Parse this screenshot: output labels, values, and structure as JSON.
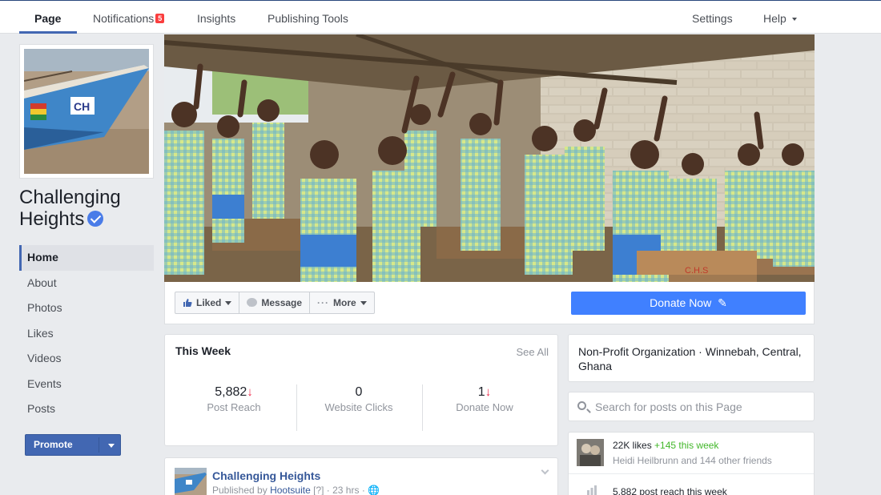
{
  "tabs": [
    {
      "label": "Page"
    },
    {
      "label": "Notifications",
      "badge": "5"
    },
    {
      "label": "Insights"
    },
    {
      "label": "Publishing Tools"
    }
  ],
  "tabs_right": [
    {
      "label": "Settings"
    },
    {
      "label": "Help"
    }
  ],
  "page": {
    "name": "Challenging Heights",
    "verified": true
  },
  "sidebar": {
    "items": [
      {
        "label": "Home",
        "active": true
      },
      {
        "label": "About"
      },
      {
        "label": "Photos"
      },
      {
        "label": "Likes"
      },
      {
        "label": "Videos"
      },
      {
        "label": "Events"
      },
      {
        "label": "Posts"
      }
    ],
    "promote_label": "Promote"
  },
  "actions": {
    "liked": "Liked",
    "message": "Message",
    "more": "More",
    "donate": "Donate Now"
  },
  "this_week": {
    "title": "This Week",
    "see_all": "See All",
    "stats": [
      {
        "value": "5,882",
        "label": "Post Reach",
        "trend": "down"
      },
      {
        "value": "0",
        "label": "Website Clicks",
        "trend": "none"
      },
      {
        "value": "1",
        "label": "Donate Now",
        "trend": "down"
      }
    ]
  },
  "post": {
    "author": "Challenging Heights",
    "published_by_prefix": "Published by",
    "publisher": "Hootsuite",
    "help": "[?]",
    "time": "23 hrs"
  },
  "about": {
    "text": "Non-Profit Organization · Winnebah, Central, Ghana"
  },
  "search": {
    "placeholder": "Search for posts on this Page"
  },
  "likes": {
    "count": "22K likes",
    "change": "+145 this week",
    "friends": "Heidi Heilbrunn and 144 other friends",
    "reach": "5,882 post reach this week"
  },
  "colors": {
    "brand": "#4267b2",
    "donate": "#4080ff",
    "badge": "#fa3e3e",
    "trend_down": "#f02849",
    "positive": "#42b72a"
  }
}
